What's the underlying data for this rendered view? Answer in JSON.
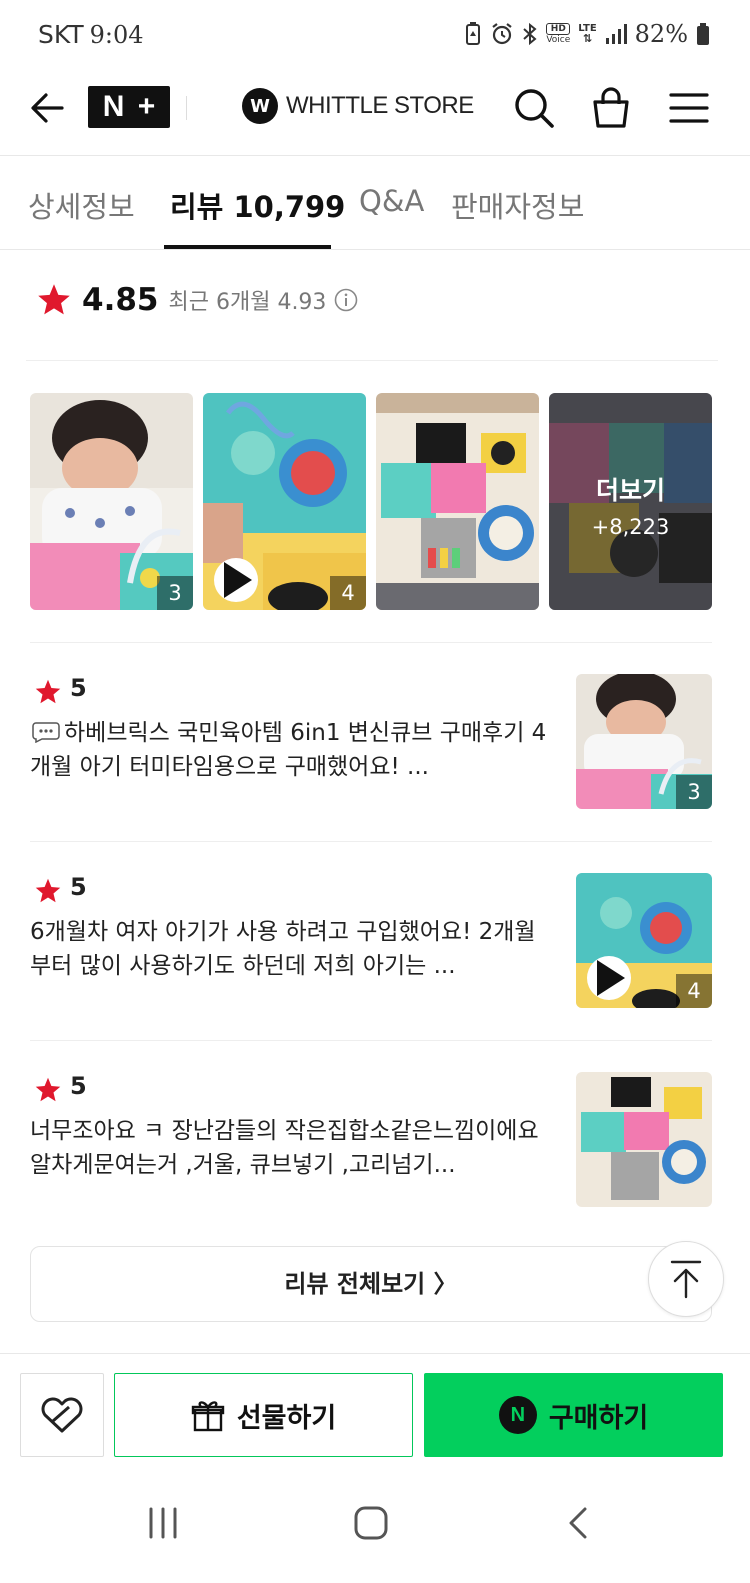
{
  "status_bar": {
    "carrier": "SKT",
    "time": "9:04",
    "hd_top": "HD",
    "hd_bottom": "Voice",
    "lte": "LTE",
    "battery": "82%"
  },
  "header": {
    "brand_badge_left": "N",
    "brand_badge_right": "+",
    "store_mark": "W",
    "store_name": "WHITTLE STORE"
  },
  "tabs": [
    {
      "label": "상세정보",
      "active": false
    },
    {
      "label": "리뷰 10,799",
      "active": true
    },
    {
      "label": "Q&A",
      "active": false
    },
    {
      "label": "판매자정보",
      "active": false
    }
  ],
  "rating": {
    "value": "4.85",
    "recent": "최근 6개월 4.93"
  },
  "gallery": {
    "items": [
      {
        "count": "3"
      },
      {
        "count": "4",
        "video": true
      },
      {},
      {}
    ],
    "more_label": "더보기",
    "more_count": "+8,223"
  },
  "reviews": [
    {
      "score": "5",
      "text": "하베브릭스 국민육아템 6in1 변신큐브 구매후기 4개월 아기 터미타임용으로 구매했어요! ...",
      "photo_count": "3"
    },
    {
      "score": "5",
      "text": "6개월차 여자 아기가 사용 하려고 구입했어요! 2개월 부터 많이 사용하기도 하던데 저희 아기는 ...",
      "photo_count": "4"
    },
    {
      "score": "5",
      "text": "너무조아요 ㅋ 장난감들의 작은집합소같은느낌이에요 알차게문여는거 ,거울, 큐브넣기 ,고리넘기...",
      "photo_count": ""
    }
  ],
  "view_all": "리뷰 전체보기 〉",
  "bottom_bar": {
    "gift": "선물하기",
    "buy": "구매하기",
    "buy_badge": "N"
  },
  "colors": {
    "accent_green": "#03cf5d",
    "star_red": "#e0182d"
  }
}
